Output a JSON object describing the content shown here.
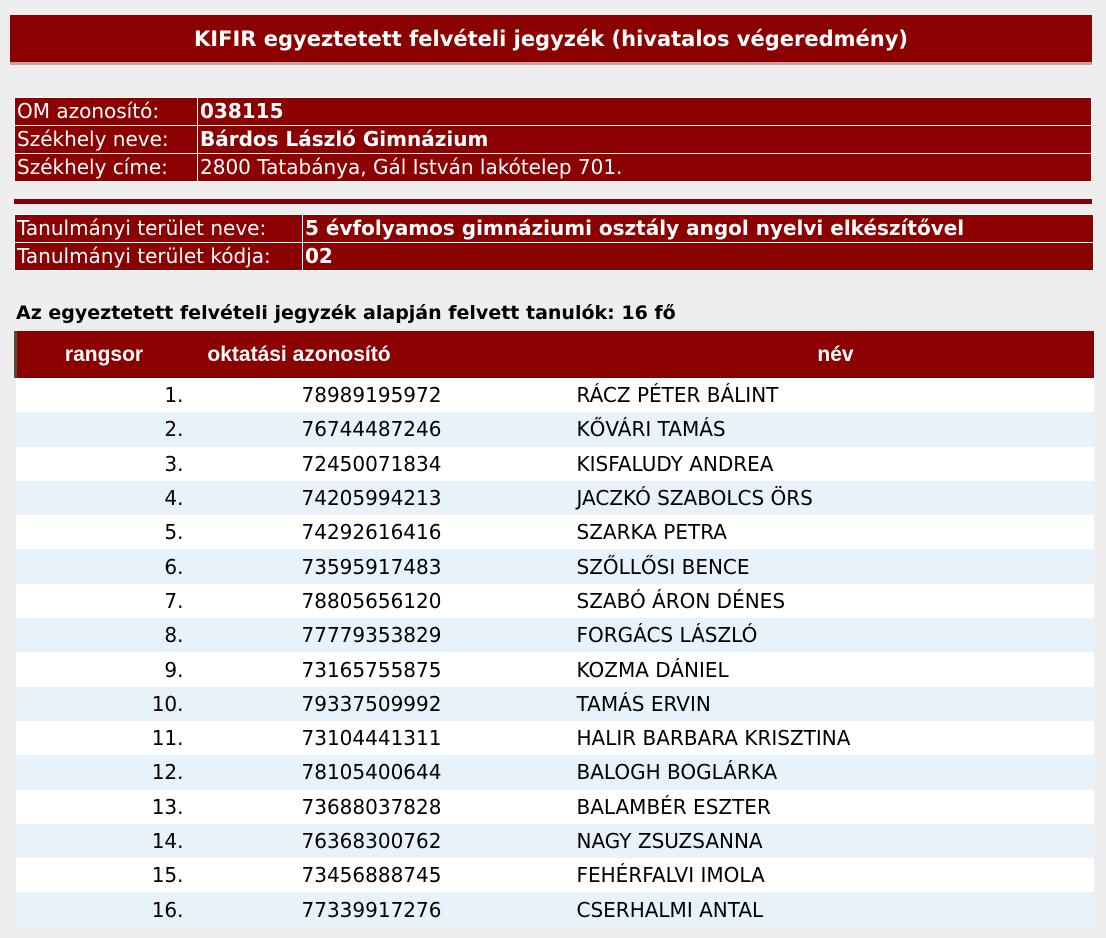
{
  "page_title": "KIFIR egyeztetett felvételi jegyzék (hivatalos végeredmény)",
  "school": {
    "om_label": "OM azonosító:",
    "om_value": "038115",
    "name_label": "Székhely neve:",
    "name_value": "Bárdos László Gimnázium",
    "address_label": "Székhely címe:",
    "address_value": "2800 Tatabánya, Gál István lakótelep 701."
  },
  "study_area": {
    "name_label": "Tanulmányi terület neve:",
    "name_value": "5 évfolyamos gimnáziumi osztály angol nyelvi elkészítővel",
    "code_label": "Tanulmányi terület kódja:",
    "code_value": "02"
  },
  "summary": "Az egyeztetett felvételi jegyzék alapján felvett tanulók: 16 fő",
  "table": {
    "headers": [
      "rangsor",
      "oktatási azonosító",
      "név"
    ],
    "rows": [
      {
        "rank": "1.",
        "id": "78989195972",
        "name": "RÁCZ PÉTER BÁLINT"
      },
      {
        "rank": "2.",
        "id": "76744487246",
        "name": "KŐVÁRI TAMÁS"
      },
      {
        "rank": "3.",
        "id": "72450071834",
        "name": "KISFALUDY ANDREA"
      },
      {
        "rank": "4.",
        "id": "74205994213",
        "name": "JACZKÓ SZABOLCS ÖRS"
      },
      {
        "rank": "5.",
        "id": "74292616416",
        "name": "SZARKA PETRA"
      },
      {
        "rank": "6.",
        "id": "73595917483",
        "name": "SZŐLLŐSI BENCE"
      },
      {
        "rank": "7.",
        "id": "78805656120",
        "name": "SZABÓ ÁRON DÉNES"
      },
      {
        "rank": "8.",
        "id": "77779353829",
        "name": "FORGÁCS LÁSZLÓ"
      },
      {
        "rank": "9.",
        "id": "73165755875",
        "name": "KOZMA DÁNIEL"
      },
      {
        "rank": "10.",
        "id": "79337509992",
        "name": "TAMÁS ERVIN"
      },
      {
        "rank": "11.",
        "id": "73104441311",
        "name": "HALIR BARBARA KRISZTINA"
      },
      {
        "rank": "12.",
        "id": "78105400644",
        "name": "BALOGH BOGLÁRKA"
      },
      {
        "rank": "13.",
        "id": "73688037828",
        "name": "BALAMBÉR ESZTER"
      },
      {
        "rank": "14.",
        "id": "76368300762",
        "name": "NAGY ZSUZSANNA"
      },
      {
        "rank": "15.",
        "id": "73456888745",
        "name": "FEHÉRFALVI IMOLA"
      },
      {
        "rank": "16.",
        "id": "77339917276",
        "name": "CSERHALMI ANTAL"
      }
    ]
  },
  "colors": {
    "header_bg": "#8b0000",
    "row_alt_bg": "#e8f2fb",
    "page_bg": "#eeeeee"
  }
}
